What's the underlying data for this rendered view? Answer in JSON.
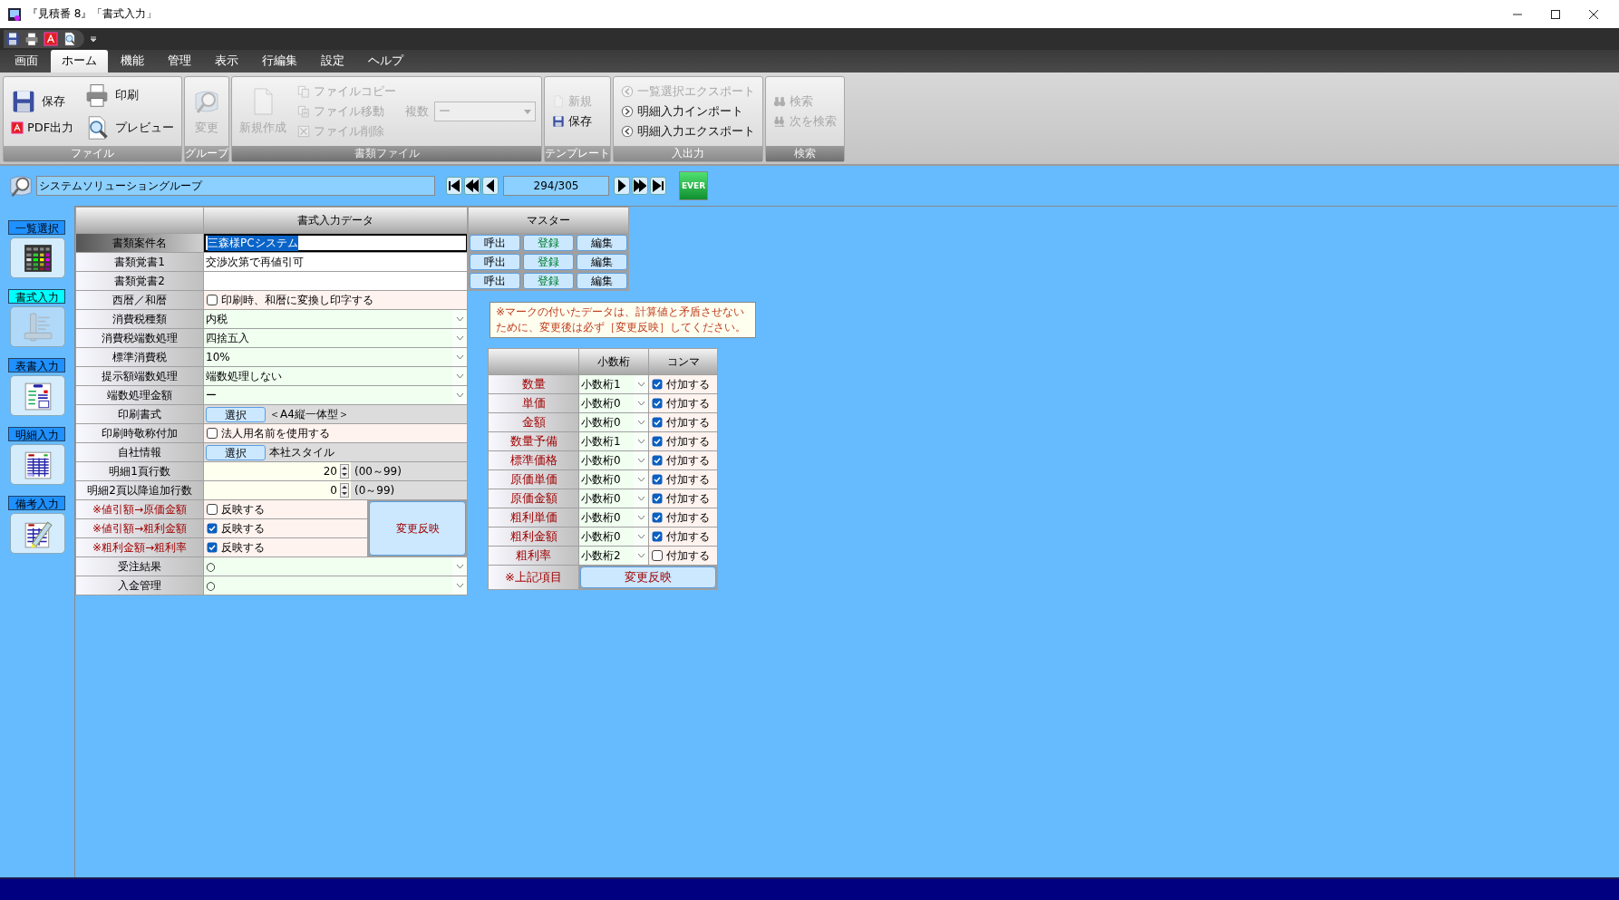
{
  "window": {
    "title": "『見積番 8』「書式入力」"
  },
  "menu_tabs": [
    {
      "label": "画面",
      "selected": false
    },
    {
      "label": "ホーム",
      "selected": true
    },
    {
      "label": "機能",
      "selected": false
    },
    {
      "label": "管理",
      "selected": false
    },
    {
      "label": "表示",
      "selected": false
    },
    {
      "label": "行編集",
      "selected": false
    },
    {
      "label": "設定",
      "selected": false
    },
    {
      "label": "ヘルプ",
      "selected": false
    }
  ],
  "ribbon": [
    {
      "label": "ファイル",
      "disabled": false,
      "columns": [
        [
          {
            "label": "保存",
            "kind": "medium",
            "disabled": false
          },
          {
            "label": "PDF出力",
            "kind": "small",
            "disabled": false
          }
        ],
        [
          {
            "label": "印刷",
            "kind": "medium",
            "disabled": false
          },
          {
            "label": "プレビュー",
            "kind": "medium",
            "disabled": false
          }
        ]
      ]
    },
    {
      "label": "グループ",
      "disabled": false,
      "columns": [
        [
          {
            "label": "変更",
            "kind": "large",
            "disabled": true
          }
        ]
      ]
    },
    {
      "label": "書類ファイル",
      "disabled": true,
      "columns": [
        [
          {
            "label": "新規作成",
            "kind": "large",
            "disabled": true
          }
        ],
        [
          {
            "label": "ファイルコピー",
            "kind": "small",
            "disabled": true
          },
          {
            "label": "ファイル移動",
            "kind": "small",
            "disabled": true
          },
          {
            "label": "ファイル削除",
            "kind": "small",
            "disabled": true
          }
        ],
        [
          {
            "label": "複数",
            "kind": "combo",
            "value": "ー",
            "disabled": true
          }
        ]
      ]
    },
    {
      "label": "テンプレート",
      "disabled": false,
      "columns": [
        [
          {
            "label": "新規",
            "kind": "small",
            "disabled": true
          },
          {
            "label": "保存",
            "kind": "small",
            "disabled": false
          }
        ]
      ]
    },
    {
      "label": "入出力",
      "disabled": false,
      "columns": [
        [
          {
            "label": "一覧選択エクスポート",
            "kind": "small",
            "disabled": true
          },
          {
            "label": "明細入力インポート",
            "kind": "small",
            "disabled": false
          },
          {
            "label": "明細入力エクスポート",
            "kind": "small",
            "disabled": false
          }
        ]
      ]
    },
    {
      "label": "検索",
      "disabled": true,
      "columns": [
        [
          {
            "label": "検索",
            "kind": "small",
            "disabled": true
          },
          {
            "label": "次を検索",
            "kind": "small",
            "disabled": true
          }
        ]
      ]
    }
  ],
  "nav": {
    "group_name": "システムソリューショングループ",
    "record": "294/305",
    "badge": "EVER"
  },
  "sidebar": [
    {
      "label": "一覧選択",
      "selected": false
    },
    {
      "label": "書式入力",
      "selected": true
    },
    {
      "label": "表書入力",
      "selected": false
    },
    {
      "label": "明細入力",
      "selected": false
    },
    {
      "label": "備考入力",
      "selected": false
    }
  ],
  "form": {
    "header": "書式入力データ",
    "master_header": "マスター",
    "apply_button": "変更反映",
    "rows": [
      {
        "label": "書類案件名",
        "kind": "text",
        "value": "三森様PCシステム",
        "focused": true,
        "marked": false,
        "master": [
          {
            "label": "呼出",
            "kind": "call"
          },
          {
            "label": "登録",
            "kind": "register"
          },
          {
            "label": "編集",
            "kind": "edit"
          }
        ]
      },
      {
        "label": "書類覚書1",
        "kind": "text",
        "value": "交渉次第で再値引可",
        "focused": false,
        "marked": false,
        "master": [
          {
            "label": "呼出",
            "kind": "call"
          },
          {
            "label": "登録",
            "kind": "register"
          },
          {
            "label": "編集",
            "kind": "edit"
          }
        ]
      },
      {
        "label": "書類覚書2",
        "kind": "text",
        "focused": false,
        "marked": false,
        "master": [
          {
            "label": "呼出",
            "kind": "call"
          },
          {
            "label": "登録",
            "kind": "register"
          },
          {
            "label": "編集",
            "kind": "edit"
          }
        ]
      },
      {
        "label": "西暦／和暦",
        "kind": "checkbox",
        "checked": false,
        "text": "印刷時、和暦に変換し印字する",
        "focused": false,
        "marked": false
      },
      {
        "label": "消費税種類",
        "kind": "select",
        "value": "内税",
        "focused": false,
        "marked": false
      },
      {
        "label": "消費税端数処理",
        "kind": "select",
        "value": "四捨五入",
        "focused": false,
        "marked": false
      },
      {
        "label": "標準消費税",
        "kind": "select",
        "value": "10%",
        "focused": false,
        "marked": false
      },
      {
        "label": "提示額端数処理",
        "kind": "select",
        "value": "端数処理しない",
        "focused": false,
        "marked": false
      },
      {
        "label": "端数処理金額",
        "kind": "select",
        "value": "ー",
        "focused": false,
        "marked": false
      },
      {
        "label": "印刷書式",
        "kind": "button",
        "button": "選択",
        "text": "＜A4縦一体型＞",
        "focused": false,
        "marked": false
      },
      {
        "label": "印刷時敬称付加",
        "kind": "checkbox",
        "checked": false,
        "text": "法人用名前を使用する",
        "focused": false,
        "marked": false
      },
      {
        "label": "自社情報",
        "kind": "button",
        "button": "選択",
        "text": "本社スタイル",
        "focused": false,
        "marked": false
      },
      {
        "label": "明細1頁行数",
        "kind": "spinner",
        "value": "20",
        "range": "(00～99)",
        "focused": false,
        "marked": false
      },
      {
        "label": "明細2頁以降追加行数",
        "kind": "spinner",
        "value": "0",
        "range": "(0～99)",
        "focused": false,
        "marked": false
      },
      {
        "label": "※値引額→原価金額",
        "kind": "reflect",
        "checked": false,
        "text": "反映する",
        "focused": false,
        "marked": true
      },
      {
        "label": "※値引額→粗利金額",
        "kind": "reflect",
        "checked": true,
        "text": "反映する",
        "focused": false,
        "marked": true
      },
      {
        "label": "※粗利金額→粗利率",
        "kind": "reflect",
        "checked": true,
        "text": "反映する",
        "focused": false,
        "marked": true
      },
      {
        "label": "受注結果",
        "kind": "select",
        "value": "○",
        "focused": false,
        "marked": false
      },
      {
        "label": "入金管理",
        "kind": "select",
        "value": "○",
        "focused": false,
        "marked": false
      }
    ]
  },
  "note": "※マークの付いたデータは、計算値と矛盾させないために、変更後は必ず［変更反映］してください。",
  "decimals": {
    "columns": [
      "小数桁",
      "コンマ"
    ],
    "footer_label": "※上記項目",
    "apply_button": "変更反映",
    "rows": [
      {
        "label": "数量",
        "digits": "小数桁1",
        "comma": true,
        "comma_label": "付加する"
      },
      {
        "label": "単価",
        "digits": "小数桁0",
        "comma": true,
        "comma_label": "付加する"
      },
      {
        "label": "金額",
        "digits": "小数桁0",
        "comma": true,
        "comma_label": "付加する"
      },
      {
        "label": "数量予備",
        "digits": "小数桁1",
        "comma": true,
        "comma_label": "付加する"
      },
      {
        "label": "標準価格",
        "digits": "小数桁0",
        "comma": true,
        "comma_label": "付加する"
      },
      {
        "label": "原価単価",
        "digits": "小数桁0",
        "comma": true,
        "comma_label": "付加する"
      },
      {
        "label": "原価金額",
        "digits": "小数桁0",
        "comma": true,
        "comma_label": "付加する"
      },
      {
        "label": "粗利単価",
        "digits": "小数桁0",
        "comma": true,
        "comma_label": "付加する"
      },
      {
        "label": "粗利金額",
        "digits": "小数桁0",
        "comma": true,
        "comma_label": "付加する"
      },
      {
        "label": "粗利率",
        "digits": "小数桁2",
        "comma": false,
        "comma_label": "付加する"
      }
    ]
  }
}
